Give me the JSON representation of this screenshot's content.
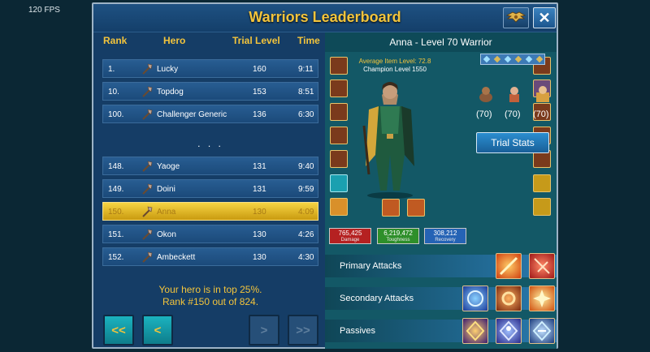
{
  "fps": "120 FPS",
  "title": "Warriors Leaderboard",
  "columns": {
    "rank": "Rank",
    "hero": "Hero",
    "level": "Trial Level",
    "time": "Time"
  },
  "top_rows": [
    {
      "rank": "1.",
      "name": "Lucky",
      "level": "160",
      "time": "9:11"
    },
    {
      "rank": "10.",
      "name": "Topdog",
      "level": "153",
      "time": "8:51"
    },
    {
      "rank": "100.",
      "name": "Challenger Generic",
      "level": "136",
      "time": "6:30"
    }
  ],
  "ellipsis": ". . .",
  "near_rows": [
    {
      "rank": "148.",
      "name": "Yaoge",
      "level": "131",
      "time": "9:40"
    },
    {
      "rank": "149.",
      "name": "Doini",
      "level": "131",
      "time": "9:59"
    },
    {
      "rank": "150.",
      "name": "Anna",
      "level": "130",
      "time": "4:09"
    },
    {
      "rank": "151.",
      "name": "Okon",
      "level": "130",
      "time": "4:26"
    },
    {
      "rank": "152.",
      "name": "Ambeckett",
      "level": "130",
      "time": "4:30"
    }
  ],
  "message": {
    "line1": "Your hero is in top 25%.",
    "line2": "Rank #150 out of 824."
  },
  "nav": {
    "first": "<<",
    "prev": "<",
    "next": ">",
    "last": ">>"
  },
  "hero": {
    "header": "Anna - Level 70 Warrior",
    "avg_item_level": "Average Item Level: 72.8",
    "champion_level": "Champion Level 1550",
    "pet_levels": [
      "(70)",
      "(70)",
      "(70)"
    ],
    "trial_stats": "Trial Stats",
    "stats": [
      {
        "value": "765,425",
        "label": "Damage",
        "color": "#b52121"
      },
      {
        "value": "6,219,472",
        "label": "Toughness",
        "color": "#2e8f2a"
      },
      {
        "value": "308,212",
        "label": "Recovery",
        "color": "#2563b5"
      }
    ]
  },
  "skills": {
    "primary": "Primary Attacks",
    "secondary": "Secondary Attacks",
    "passives": "Passives"
  },
  "colors": {
    "gold": "#f3c43c",
    "panel": "#153d66",
    "accent": "#135866"
  }
}
